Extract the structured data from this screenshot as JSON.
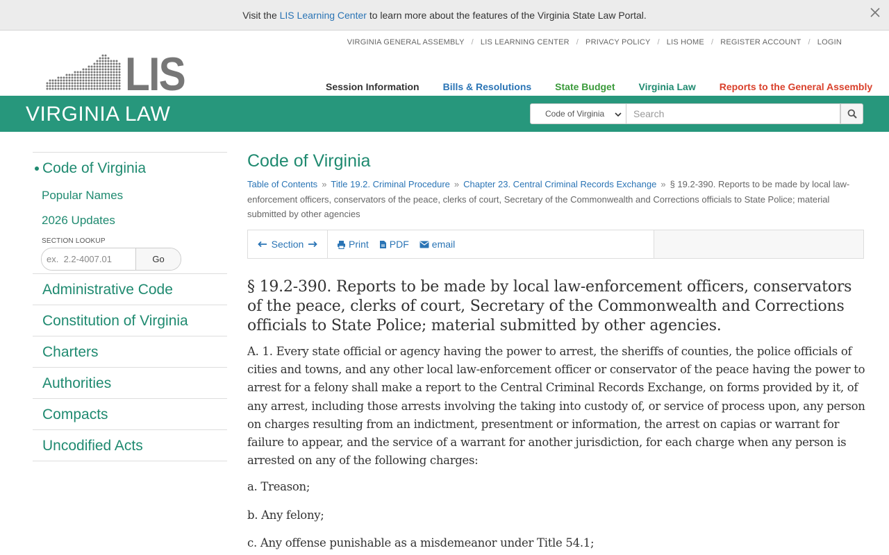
{
  "banner": {
    "prefix": "Visit the",
    "link": "LIS Learning Center",
    "suffix": "to learn more about the features of the Virginia State Law Portal."
  },
  "utility_nav": [
    "VIRGINIA GENERAL ASSEMBLY",
    "LIS LEARNING CENTER",
    "PRIVACY POLICY",
    "LIS HOME",
    "REGISTER ACCOUNT",
    "LOGIN"
  ],
  "logo_text": "LIS",
  "main_nav": [
    {
      "label": "Session Information",
      "color": "#333333"
    },
    {
      "label": "Bills & Resolutions",
      "color": "#2a74b5"
    },
    {
      "label": "State Budget",
      "color": "#3a9a3a"
    },
    {
      "label": "Virginia Law",
      "color": "#1f8a70"
    },
    {
      "label": "Reports to the General Assembly",
      "color": "#d9402b"
    }
  ],
  "greenbar": {
    "title": "VIRGINIA LAW",
    "select_value": "Code of Virginia",
    "search_placeholder": "Search",
    "color": "#27977c"
  },
  "sidebar": {
    "active": "Code of Virginia",
    "sub_items": [
      "Popular Names",
      "2026 Updates"
    ],
    "lookup_label": "SECTION LOOKUP",
    "lookup_placeholder": "ex.  2.2-4007.01",
    "lookup_go": "Go",
    "items": [
      "Administrative Code",
      "Constitution of Virginia",
      "Charters",
      "Authorities",
      "Compacts",
      "Uncodified Acts"
    ]
  },
  "main": {
    "title": "Code of Virginia",
    "breadcrumbs": [
      "Table of Contents",
      "Title 19.2. Criminal Procedure",
      "Chapter 23. Central Criminal Records Exchange"
    ],
    "breadcrumb_current": "§ 19.2-390. Reports to be made by local law-enforcement officers, conservators of the peace, clerks of court, Secretary of the Commonwealth and Corrections officials to State Police; material submitted by other agencies",
    "toolbar": {
      "section": "Section",
      "print": "Print",
      "pdf": "PDF",
      "email": "email"
    },
    "section_title": "§ 19.2-390. Reports to be made by local law-enforcement officers, conservators of the peace, clerks of court, Secretary of the Commonwealth and Corrections officials to State Police; material submitted by other agencies.",
    "paragraph": "A. 1. Every state official or agency having the power to arrest, the sheriffs of counties, the police officials of cities and towns, and any other local law-enforcement officer or conservator of the peace having the power to arrest for a felony shall make a report to the Central Criminal Records Exchange, on forms provided by it, of any arrest, including those arrests involving the taking into custody of, or service of process upon, any person on charges resulting from an indictment, presentment or information, the arrest on capias or warrant for failure to appear, and the service of a warrant for another jurisdiction, for each charge when any person is arrested on any of the following charges:",
    "items": [
      "a. Treason;",
      "b. Any felony;",
      "c. Any offense punishable as a misdemeanor under Title 54.1;"
    ]
  }
}
